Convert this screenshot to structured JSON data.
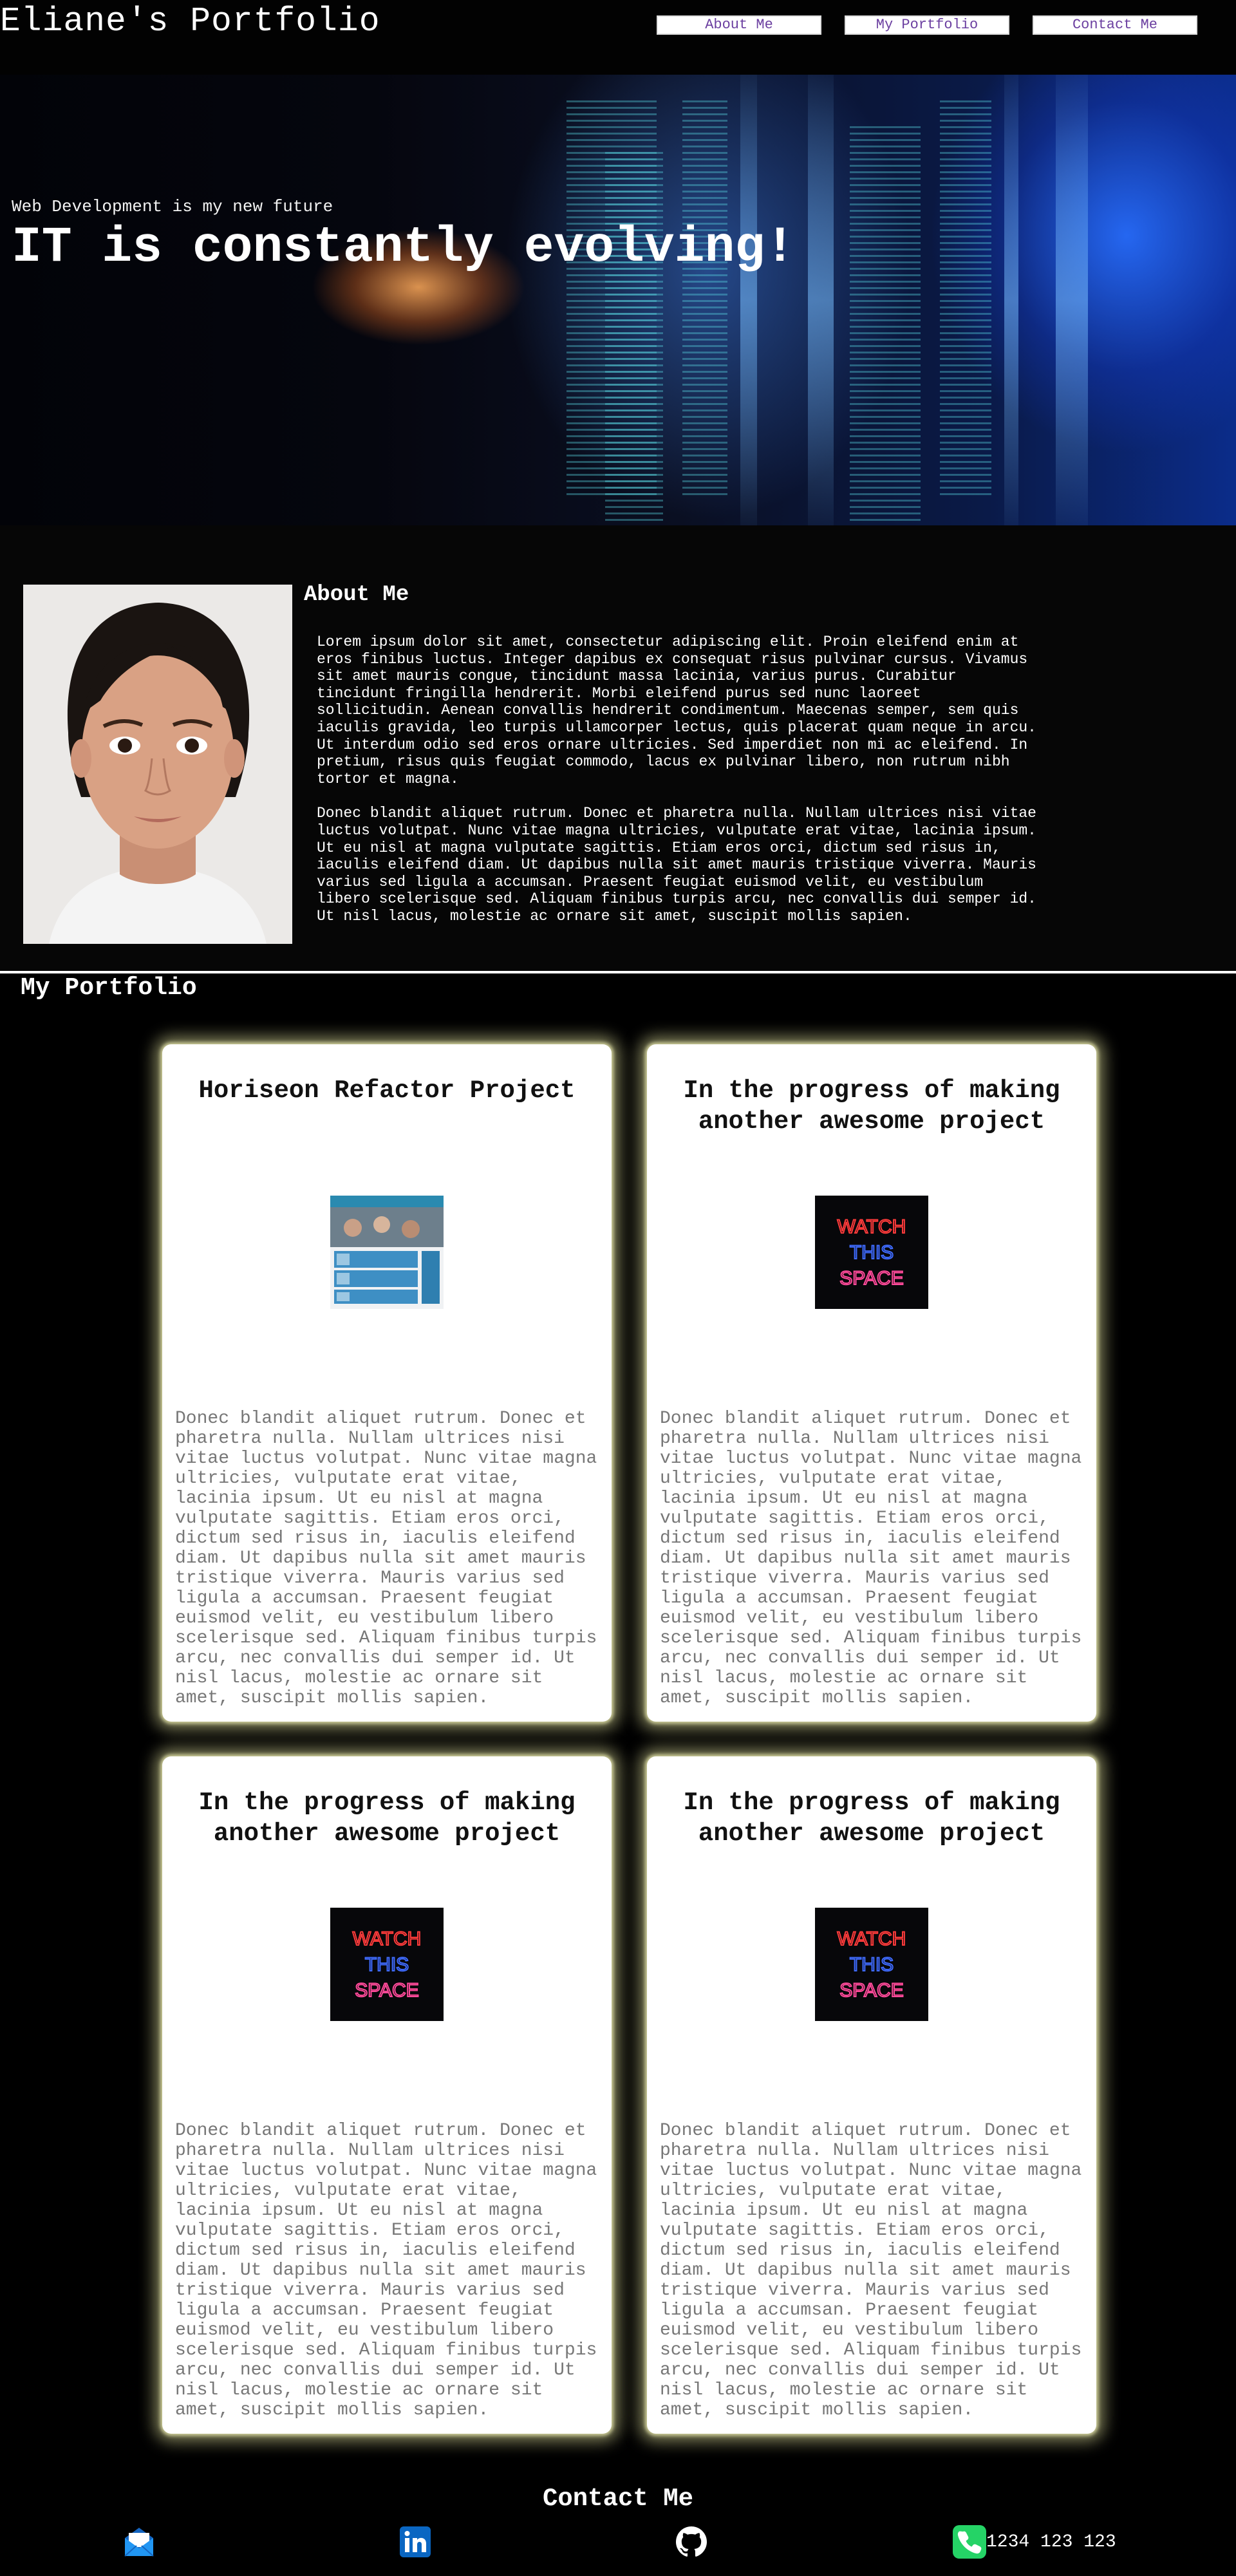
{
  "header": {
    "title": "Eliane's Portfolio",
    "nav": [
      {
        "label": "About Me"
      },
      {
        "label": "My Portfolio"
      },
      {
        "label": "Contact Me"
      }
    ]
  },
  "hero": {
    "subtitle": "Web Development is my new future",
    "title": "IT is constantly evolving!"
  },
  "about": {
    "title": "About Me",
    "paragraphs": [
      "Lorem ipsum dolor sit amet, consectetur adipiscing elit. Proin eleifend enim at eros finibus luctus. Integer dapibus ex consequat risus pulvinar cursus. Vivamus sit amet mauris congue, tincidunt massa lacinia, varius purus. Curabitur tincidunt fringilla hendrerit. Morbi eleifend purus sed nunc laoreet sollicitudin. Aenean convallis hendrerit condimentum. Maecenas semper, sem quis iaculis gravida, leo turpis ullamcorper lectus, quis placerat quam neque in arcu. Ut interdum odio sed eros ornare ultricies. Sed imperdiet non mi ac eleifend. In pretium, risus quis feugiat commodo, lacus ex pulvinar libero, non rutrum nibh tortor et magna.",
      "Donec blandit aliquet rutrum. Donec et pharetra nulla. Nullam ultrices nisi vitae luctus volutpat. Nunc vitae magna ultricies, vulputate erat vitae, lacinia ipsum. Ut eu nisl at magna vulputate sagittis. Etiam eros orci, dictum sed risus in, iaculis eleifend diam. Ut dapibus nulla sit amet mauris tristique viverra. Mauris varius sed ligula a accumsan. Praesent feugiat euismod velit, eu vestibulum libero scelerisque sed. Aliquam finibus turpis arcu, nec convallis dui semper id. Ut nisl lacus, molestie ac ornare sit amet, suscipit mollis sapien."
    ]
  },
  "portfolio": {
    "title": "My Portfolio",
    "cards": [
      {
        "title": "Horiseon Refactor Project",
        "image": "horiseon-website-thumbnail",
        "text": "Donec blandit aliquet rutrum. Donec et pharetra nulla. Nullam ultrices nisi vitae luctus volutpat. Nunc vitae magna ultricies, vulputate erat vitae, lacinia ipsum. Ut eu nisl at magna vulputate sagittis. Etiam eros orci, dictum sed risus in, iaculis eleifend diam. Ut dapibus nulla sit amet mauris tristique viverra. Mauris varius sed ligula a accumsan. Praesent feugiat euismod velit, eu vestibulum libero scelerisque sed. Aliquam finibus turpis arcu, nec convallis dui semper id. Ut nisl lacus, molestie ac ornare sit amet, suscipit mollis sapien."
      },
      {
        "title": "In the progress of making another awesome project",
        "image": "watch-this-space-neon",
        "text": "Donec blandit aliquet rutrum. Donec et pharetra nulla. Nullam ultrices nisi vitae luctus volutpat. Nunc vitae magna ultricies, vulputate erat vitae, lacinia ipsum. Ut eu nisl at magna vulputate sagittis. Etiam eros orci, dictum sed risus in, iaculis eleifend diam. Ut dapibus nulla sit amet mauris tristique viverra. Mauris varius sed ligula a accumsan. Praesent feugiat euismod velit, eu vestibulum libero scelerisque sed. Aliquam finibus turpis arcu, nec convallis dui semper id. Ut nisl lacus, molestie ac ornare sit amet, suscipit mollis sapien."
      },
      {
        "title": "In the progress of making another awesome project",
        "image": "watch-this-space-neon",
        "text": "Donec blandit aliquet rutrum. Donec et pharetra nulla. Nullam ultrices nisi vitae luctus volutpat. Nunc vitae magna ultricies, vulputate erat vitae, lacinia ipsum. Ut eu nisl at magna vulputate sagittis. Etiam eros orci, dictum sed risus in, iaculis eleifend diam. Ut dapibus nulla sit amet mauris tristique viverra. Mauris varius sed ligula a accumsan. Praesent feugiat euismod velit, eu vestibulum libero scelerisque sed. Aliquam finibus turpis arcu, nec convallis dui semper id. Ut nisl lacus, molestie ac ornare sit amet, suscipit mollis sapien."
      },
      {
        "title": "In the progress of making another awesome project",
        "image": "watch-this-space-neon",
        "text": "Donec blandit aliquet rutrum. Donec et pharetra nulla. Nullam ultrices nisi vitae luctus volutpat. Nunc vitae magna ultricies, vulputate erat vitae, lacinia ipsum. Ut eu nisl at magna vulputate sagittis. Etiam eros orci, dictum sed risus in, iaculis eleifend diam. Ut dapibus nulla sit amet mauris tristique viverra. Mauris varius sed ligula a accumsan. Praesent feugiat euismod velit, eu vestibulum libero scelerisque sed. Aliquam finibus turpis arcu, nec convallis dui semper id. Ut nisl lacus, molestie ac ornare sit amet, suscipit mollis sapien."
      }
    ],
    "neon_sign": {
      "line1": "WATCH",
      "line2": "THIS",
      "line3": "SPACE"
    }
  },
  "contact": {
    "title": "Contact Me",
    "icons": [
      "mail-icon",
      "linkedin-icon",
      "github-icon",
      "phone-icon"
    ],
    "phone": "1234 123 123"
  },
  "colors": {
    "background": "#000000",
    "nav_text": "#6b3fa0",
    "card_glow": "#e6e6a0",
    "card_text": "#777777",
    "linkedin": "#0a66c2",
    "mail": "#1e88e5",
    "phone": "#25d366"
  }
}
